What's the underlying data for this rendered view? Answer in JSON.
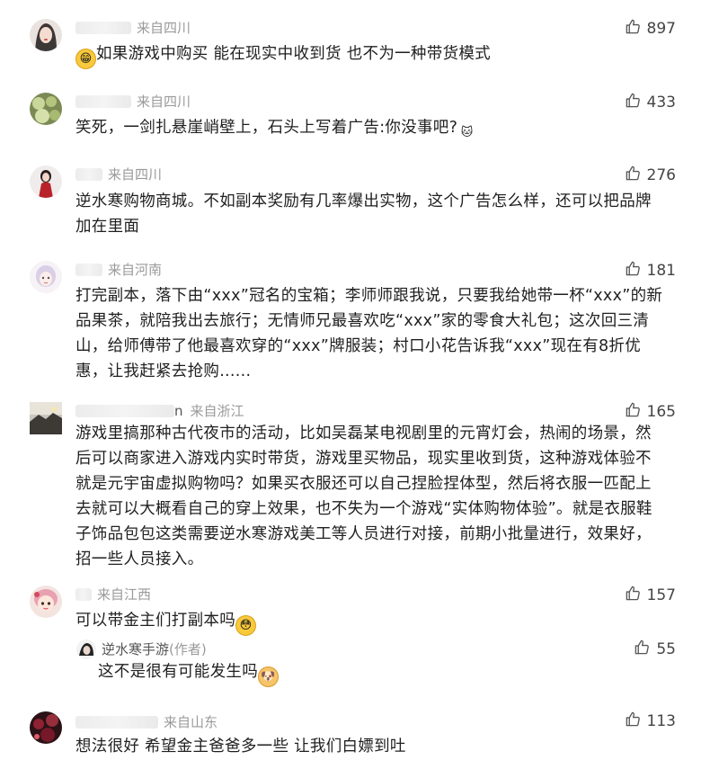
{
  "comments": [
    {
      "location": "来自四川",
      "likes": "897",
      "text": "如果游戏中购买 能在现实中收到货 也不为一种带货模式"
    },
    {
      "location": "来自四川",
      "likes": "433",
      "text": "笑死，一剑扎悬崖峭壁上，石头上写着广告:你没事吧?"
    },
    {
      "location": "来自四川",
      "likes": "276",
      "text_lines": [
        "逆水寒购物商城。不如副本奖励有几率爆出实物，这个广告怎么样，还可以把品牌",
        "加在里面"
      ]
    },
    {
      "location": "来自河南",
      "likes": "181",
      "text_lines": [
        "打完副本，落下由“xxx”冠名的宝箱；李师师跟我说，只要我给她带一杯“xxx”的新",
        "品果茶，就陪我出去旅行；无情师兄最喜欢吃“xxx”家的零食大礼包；这次回三清",
        "山，给师傅带了他最喜欢穿的“xxx”牌服装；村口小花告诉我“xxx”现在有8折优",
        "惠，让我赶紧去抢购......"
      ]
    },
    {
      "name_tail": "n",
      "location": "来自浙江",
      "likes": "165",
      "text_lines": [
        "游戏里搞那种古代夜市的活动，比如吴磊某电视剧里的元宵灯会，热闹的场景，然",
        "后可以商家进入游戏内实时带货，游戏里买物品，现实里收到货，这种游戏体验不",
        "就是元宇宙虚拟购物吗？如果买衣服还可以自己捏脸捏体型，然后将衣服一匹配上",
        "去就可以大概看自己的穿上效果，也不失为一个游戏“实体购物体验”。就是衣服鞋",
        "子饰品包包这类需要逆水寒游戏美工等人员进行对接，前期小批量进行，效果好，",
        "招一些人员接入。"
      ]
    },
    {
      "location": "来自江西",
      "likes": "157",
      "text": "可以带金主们打副本吗",
      "reply": {
        "author": "逆水寒手游",
        "author_tag": "(作者)",
        "likes": "55",
        "text": "这不是很有可能发生吗"
      }
    },
    {
      "location": "来自山东",
      "likes": "113",
      "text": "想法很好 希望金主爸爸多一些 让我们白嫖到吐"
    }
  ],
  "icons": {
    "like": "thumbs-up-icon",
    "grin": "grinning-emoji",
    "cat": "cat-face-emoji",
    "dog": "dog-face-emoji"
  },
  "colors": {
    "meta_text": "#9a9a9a",
    "body_text": "#1f1f1f",
    "like_text": "#444444"
  }
}
